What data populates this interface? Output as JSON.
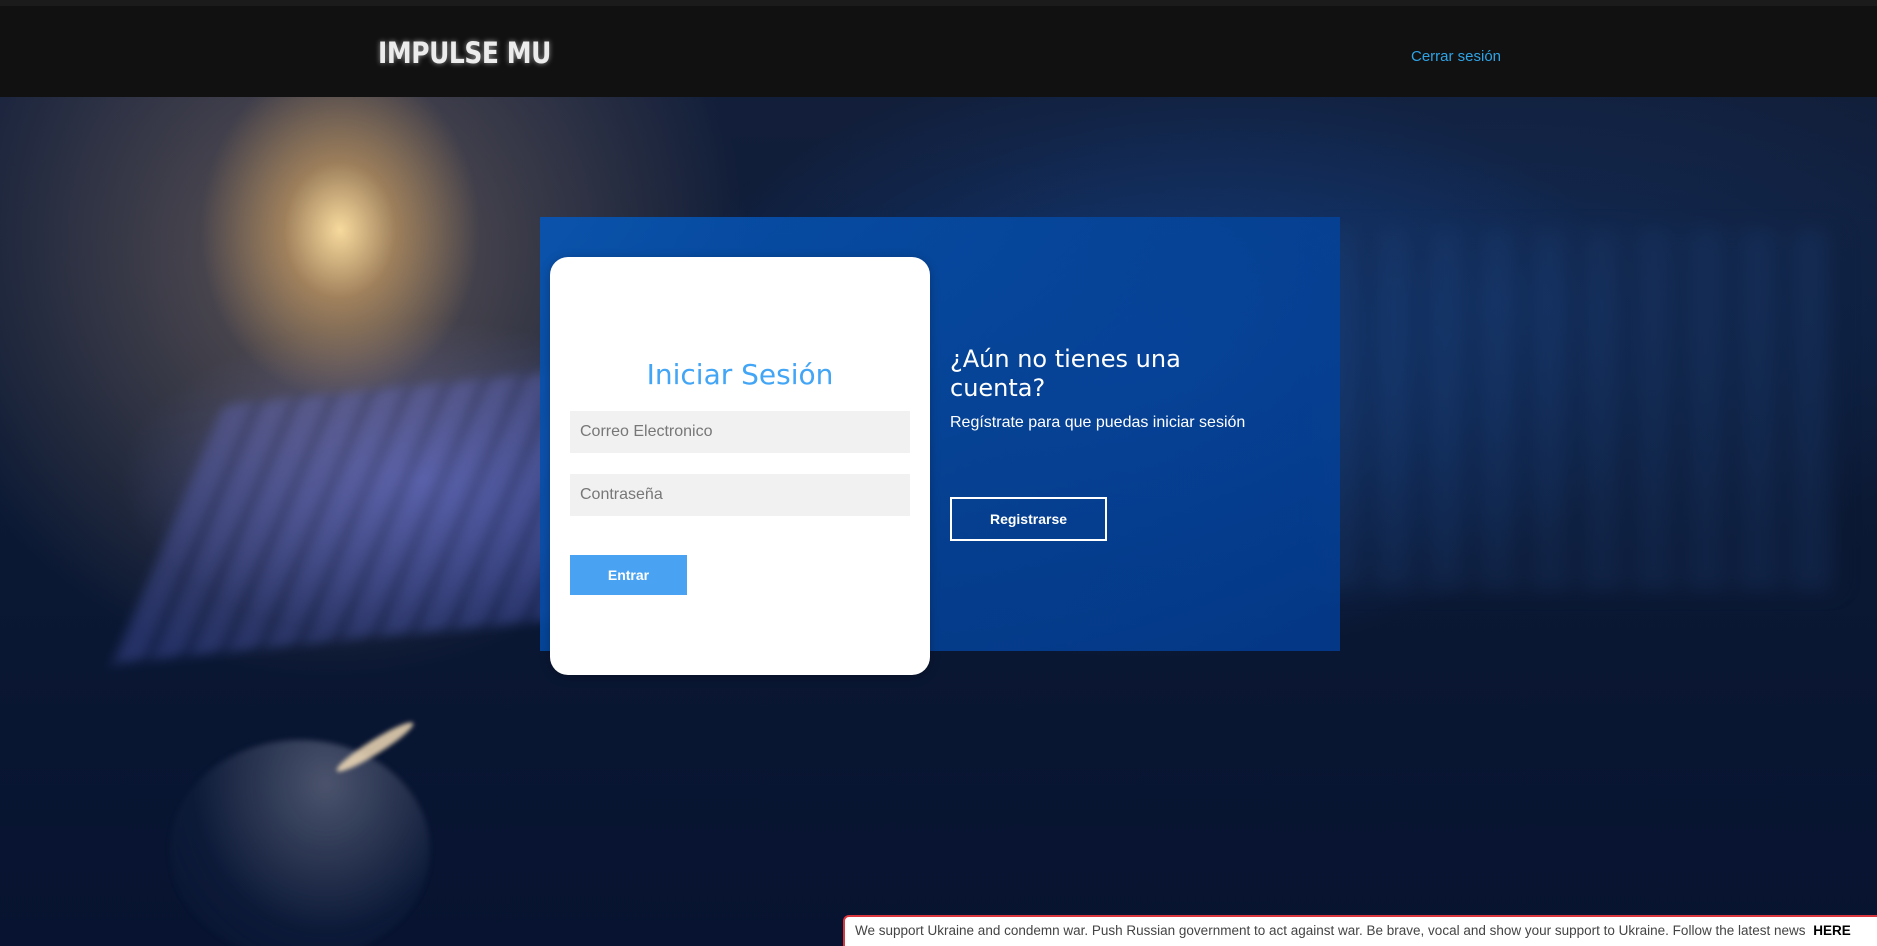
{
  "header": {
    "logo": "IMPULSE MU",
    "logout_label": "Cerrar sesión"
  },
  "login": {
    "title": "Iniciar Sesión",
    "email_placeholder": "Correo Electronico",
    "email_value": "",
    "password_placeholder": "Contraseña",
    "password_value": "",
    "submit_label": "Entrar"
  },
  "register": {
    "title": "¿Aún no tienes una cuenta?",
    "text": "Regístrate para que puedas iniciar sesión",
    "button_label": "Registrarse"
  },
  "banner": {
    "text": "We support Ukraine and condemn war. Push Russian government to act against war. Be brave, vocal and show your support to Ukraine. Follow the latest news",
    "link_label": "HERE"
  },
  "colors": {
    "accent": "#42a5f5",
    "button": "#4aa3f2",
    "panel": "#0655b4",
    "header": "#111111",
    "link": "#2ea3e6",
    "banner_border": "#d9363e"
  }
}
